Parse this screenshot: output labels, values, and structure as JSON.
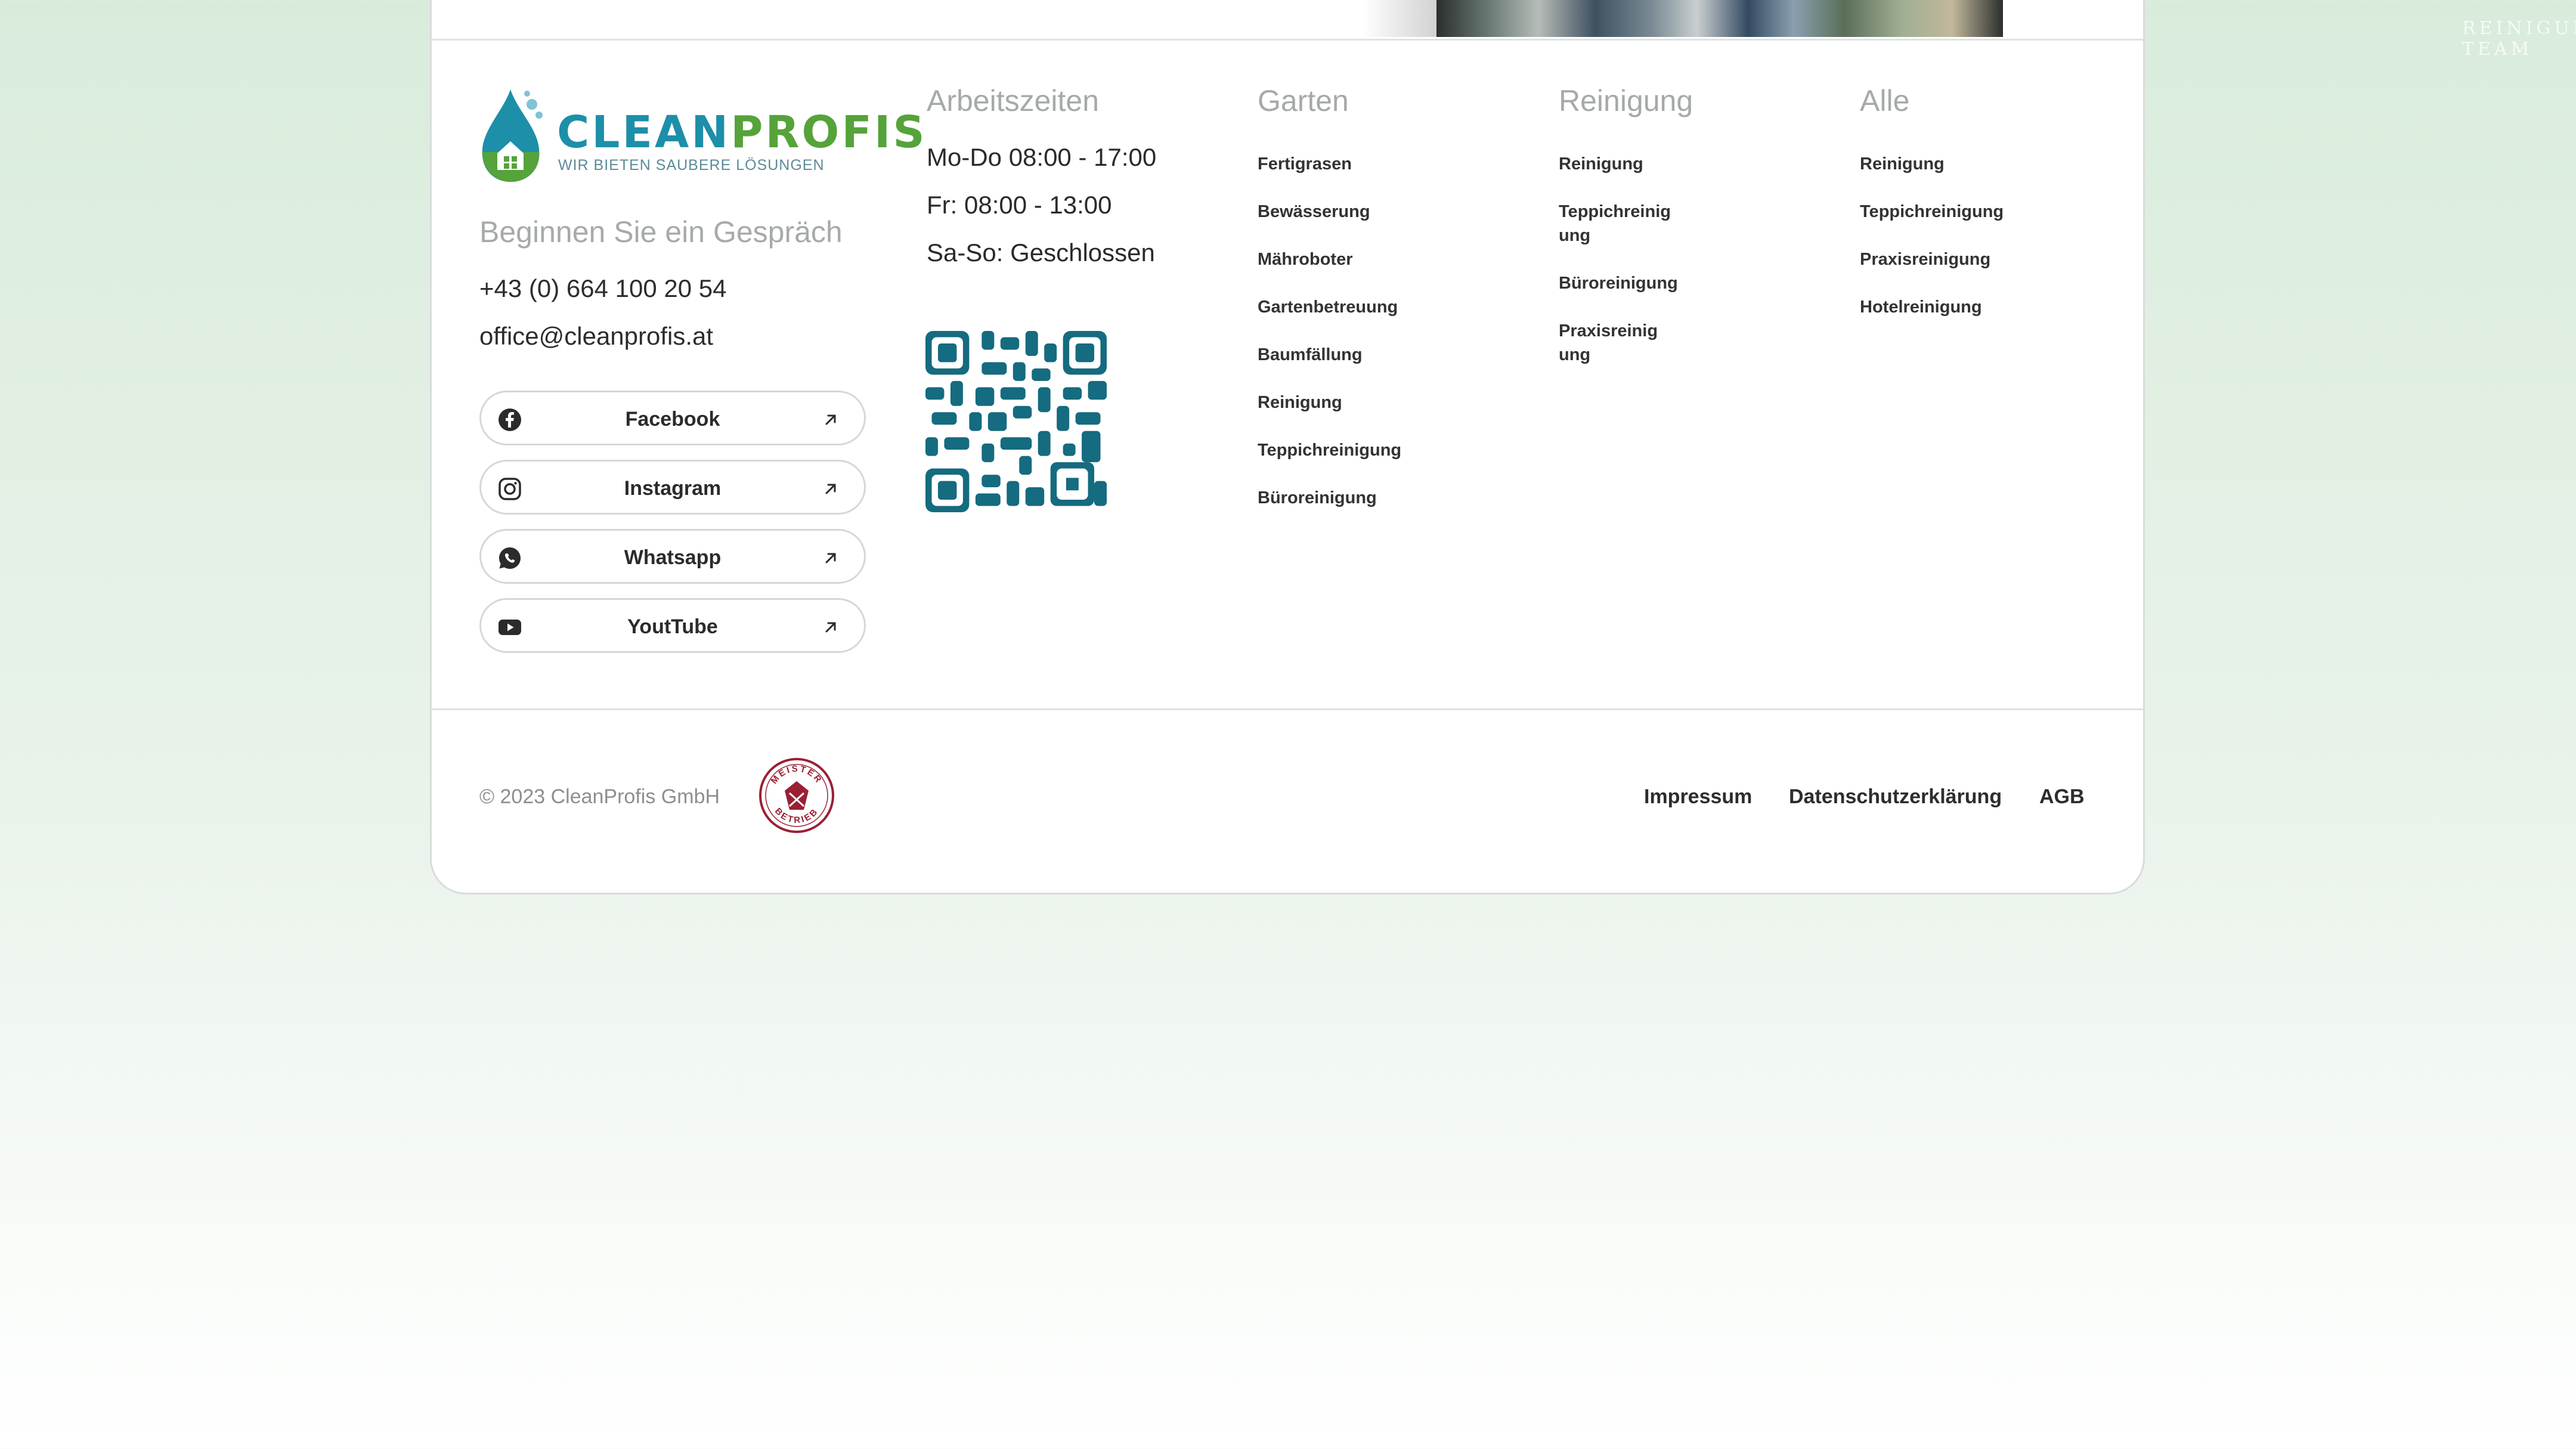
{
  "brand": {
    "word_part1": "CLEAN",
    "word_part2": "PROFIS",
    "tagline": "WIR BIETEN SAUBERE LÖSUNGEN",
    "color_blue": "#1d8fa8",
    "color_green": "#55a33a"
  },
  "contact": {
    "heading": "Beginnen Sie ein Gespräch",
    "phone": "+43 (0) 664 100 20 54",
    "email": "office@cleanprofis.at"
  },
  "social": [
    {
      "label": "Facebook",
      "icon": "facebook-icon"
    },
    {
      "label": "Instagram",
      "icon": "instagram-icon"
    },
    {
      "label": "Whatsapp",
      "icon": "whatsapp-icon"
    },
    {
      "label": "YoutTube",
      "icon": "youtube-icon"
    }
  ],
  "hours": {
    "heading": "Arbeitszeiten",
    "lines": [
      "Mo-Do 08:00 - 17:00",
      "Fr: 08:00 - 13:00",
      "Sa-So: Geschlossen"
    ],
    "qr_color": "#156b7f"
  },
  "garten": {
    "heading": "Garten",
    "links": [
      "Fertigrasen",
      "Bewässerung",
      "Mähroboter",
      "Gartenbetreuung",
      "Baumfällung",
      "Reinigung",
      "Teppichreinigung",
      "Büroreinigung"
    ]
  },
  "reinigung": {
    "heading": "Reinigung",
    "links": [
      "Reinigung",
      "Teppichreinig ung",
      "Büroreinigung",
      "Praxisreinig ung"
    ]
  },
  "alle": {
    "heading": "Alle",
    "links": [
      "Reinigung",
      "Teppichreinigung",
      "Praxisreinigung",
      "Hotelreinigung"
    ]
  },
  "footer": {
    "copyright": "© 2023 CleanProfis GmbH",
    "seal_top": "MEISTER",
    "seal_bottom": "BETRIEB",
    "links": [
      "Impressum",
      "Datenschutzerklärung",
      "AGB"
    ]
  },
  "banner": {
    "caption": "REINIGUNG TEAM"
  }
}
